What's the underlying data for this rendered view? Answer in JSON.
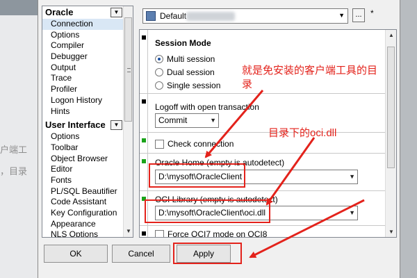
{
  "background": {
    "fragment1": "户端工",
    "fragment2": "，目录"
  },
  "toolbar": {
    "profile_value": "Default",
    "more_button": "...",
    "star": "*"
  },
  "tree": {
    "groups": [
      {
        "label": "Oracle",
        "items": [
          "Connection",
          "Options",
          "Compiler",
          "Debugger",
          "Output",
          "Trace",
          "Profiler",
          "Logon History",
          "Hints"
        ]
      },
      {
        "label": "User Interface",
        "items": [
          "Options",
          "Toolbar",
          "Object Browser",
          "Editor",
          "Fonts",
          "PL/SQL Beautifier",
          "Code Assistant",
          "Key Configuration",
          "Appearance",
          "NLS Options"
        ]
      }
    ],
    "selected": "Connection"
  },
  "session": {
    "title": "Session Mode",
    "options": [
      "Multi session",
      "Dual session",
      "Single session"
    ],
    "selected": "Multi session"
  },
  "logoff": {
    "label": "Logoff with open transaction",
    "value": "Commit"
  },
  "check_connection": {
    "label": "Check connection"
  },
  "oracle_home": {
    "label": "Oracle Home (empty is autodetect)",
    "value": "D:\\mysoft\\OracleClient"
  },
  "oci_library": {
    "label": "OCI Library (empty is autodetect)",
    "value": "D:\\mysoft\\OracleClient\\oci.dll"
  },
  "partial_row": {
    "label": "Force OCI7 mode on OCI8"
  },
  "buttons": {
    "ok": "OK",
    "cancel": "Cancel",
    "apply": "Apply"
  },
  "annotations": {
    "note1_line1": "就是免安装的客户端工具的目",
    "note1_line2": "录",
    "note2": "目录下的oci.dll",
    "color": "#e3221b"
  }
}
